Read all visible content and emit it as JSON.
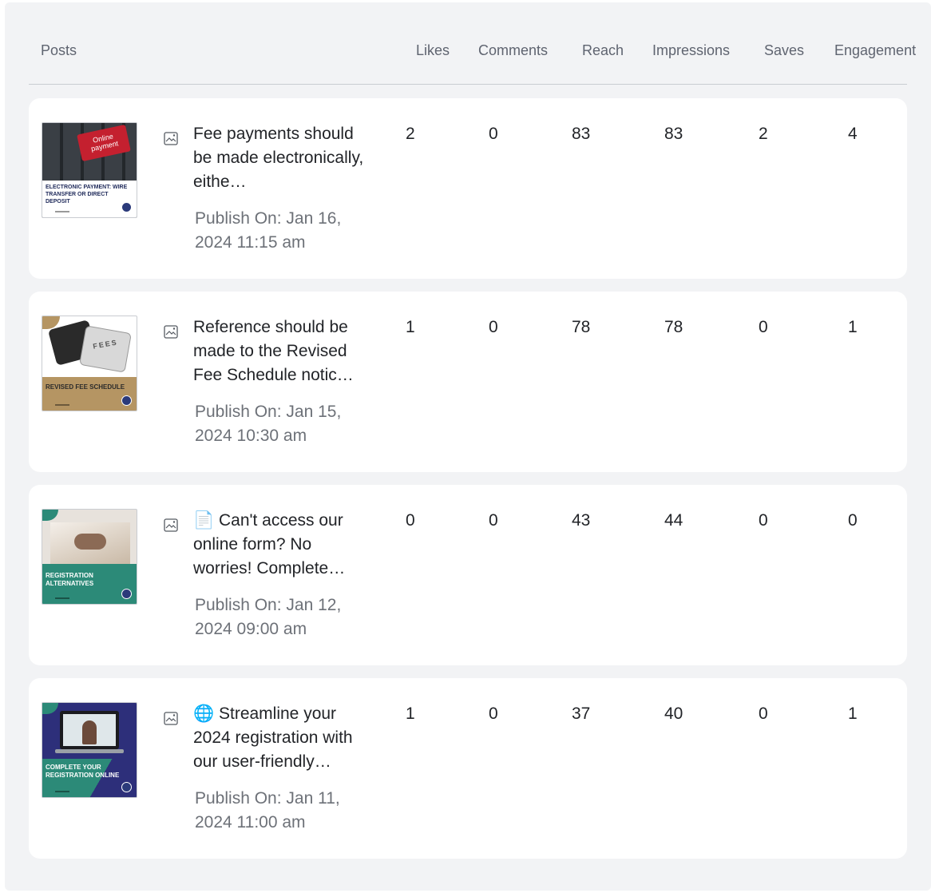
{
  "columns": {
    "posts": "Posts",
    "likes": "Likes",
    "comments": "Comments",
    "reach": "Reach",
    "impressions": "Impressions",
    "saves": "Saves",
    "engagement": "Engagement"
  },
  "rows": [
    {
      "thumb_caption": "ELECTRONIC PAYMENT: WIRE TRANSFER OR DIRECT DEPOSIT",
      "thumb_key_text": "Online payment",
      "title": "Fee payments should be made electronically, eithe…",
      "date": "Publish On:  Jan 16, 2024 11:15 am",
      "likes": "2",
      "comments": "0",
      "reach": "83",
      "impressions": "83",
      "saves": "2",
      "engagement": "4"
    },
    {
      "thumb_caption": "REVISED FEE SCHEDULE",
      "thumb_key_text": "FEES",
      "title": "Reference should be made to the Revised Fee Schedule notic…",
      "date": "Publish On:  Jan 15, 2024 10:30 am",
      "likes": "1",
      "comments": "0",
      "reach": "78",
      "impressions": "78",
      "saves": "0",
      "engagement": "1"
    },
    {
      "thumb_caption": "REGISTRATION ALTERNATIVES",
      "thumb_key_text": "",
      "title": "📄 Can't access our online form? No worries! Complete…",
      "date": "Publish On:  Jan 12, 2024 09:00 am",
      "likes": "0",
      "comments": "0",
      "reach": "43",
      "impressions": "44",
      "saves": "0",
      "engagement": "0"
    },
    {
      "thumb_caption": "COMPLETE YOUR REGISTRATION ONLINE",
      "thumb_key_text": "",
      "title": "🌐 Streamline your 2024 registration with our user-friendly…",
      "date": "Publish On:  Jan 11, 2024 11:00 am",
      "likes": "1",
      "comments": "0",
      "reach": "37",
      "impressions": "40",
      "saves": "0",
      "engagement": "1"
    }
  ],
  "icons": {
    "post_type": "image-icon",
    "seal": "seal-icon"
  },
  "colors": {
    "panel_bg": "#f2f3f5",
    "card_bg": "#ffffff",
    "text": "#222428",
    "muted": "#6d7178",
    "thumb1_bg": "#2f3338",
    "thumb1_accent": "#c4202f",
    "thumb2_bg": "#b59563",
    "thumb3_bg": "#2c8a78",
    "thumb4_bg": "#2d2f7a"
  }
}
